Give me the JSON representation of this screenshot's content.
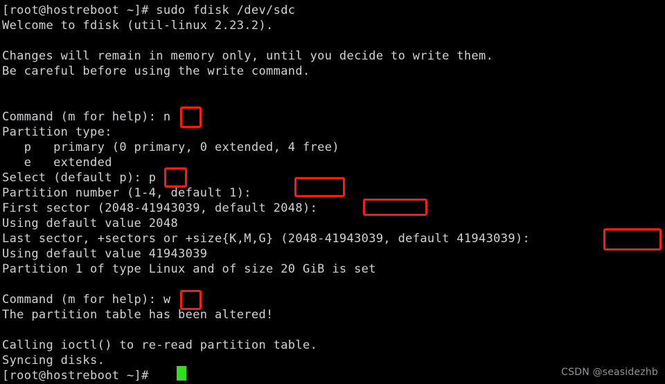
{
  "terminal": {
    "background_color": "#000000",
    "text_color": "#cfd2d6",
    "highlight_color": "#fb1b10",
    "cursor_color": "#2ee01c",
    "lines": [
      "[root@hostreboot ~]# sudo fdisk /dev/sdc",
      "Welcome to fdisk (util-linux 2.23.2).",
      "",
      "Changes will remain in memory only, until you decide to write them.",
      "Be careful before using the write command.",
      "",
      "",
      "Command (m for help): n",
      "Partition type:",
      "   p   primary (0 primary, 0 extended, 4 free)",
      "   e   extended",
      "Select (default p): p",
      "Partition number (1-4, default 1): ",
      "First sector (2048-41943039, default 2048): ",
      "Using default value 2048",
      "Last sector, +sectors or +size{K,M,G} (2048-41943039, default 41943039): ",
      "Using default value 41943039",
      "Partition 1 of type Linux and of size 20 GiB is set",
      "",
      "Command (m for help): w",
      "The partition table has been altered!",
      "",
      "Calling ioctl() to re-read partition table.",
      "Syncing disks.",
      "[root@hostreboot ~]# "
    ]
  },
  "annotations": {
    "boxes": [
      {
        "label": "n",
        "note": "new-partition-command-input"
      },
      {
        "label": "p",
        "note": "primary-partition-type-input"
      },
      {
        "label": "",
        "note": "partition-number-default-input"
      },
      {
        "label": "",
        "note": "first-sector-default-input"
      },
      {
        "label": "",
        "note": "last-sector-default-input"
      },
      {
        "label": "w",
        "note": "write-command-input"
      }
    ]
  },
  "watermark": {
    "text": "CSDN @seasidezhb"
  }
}
